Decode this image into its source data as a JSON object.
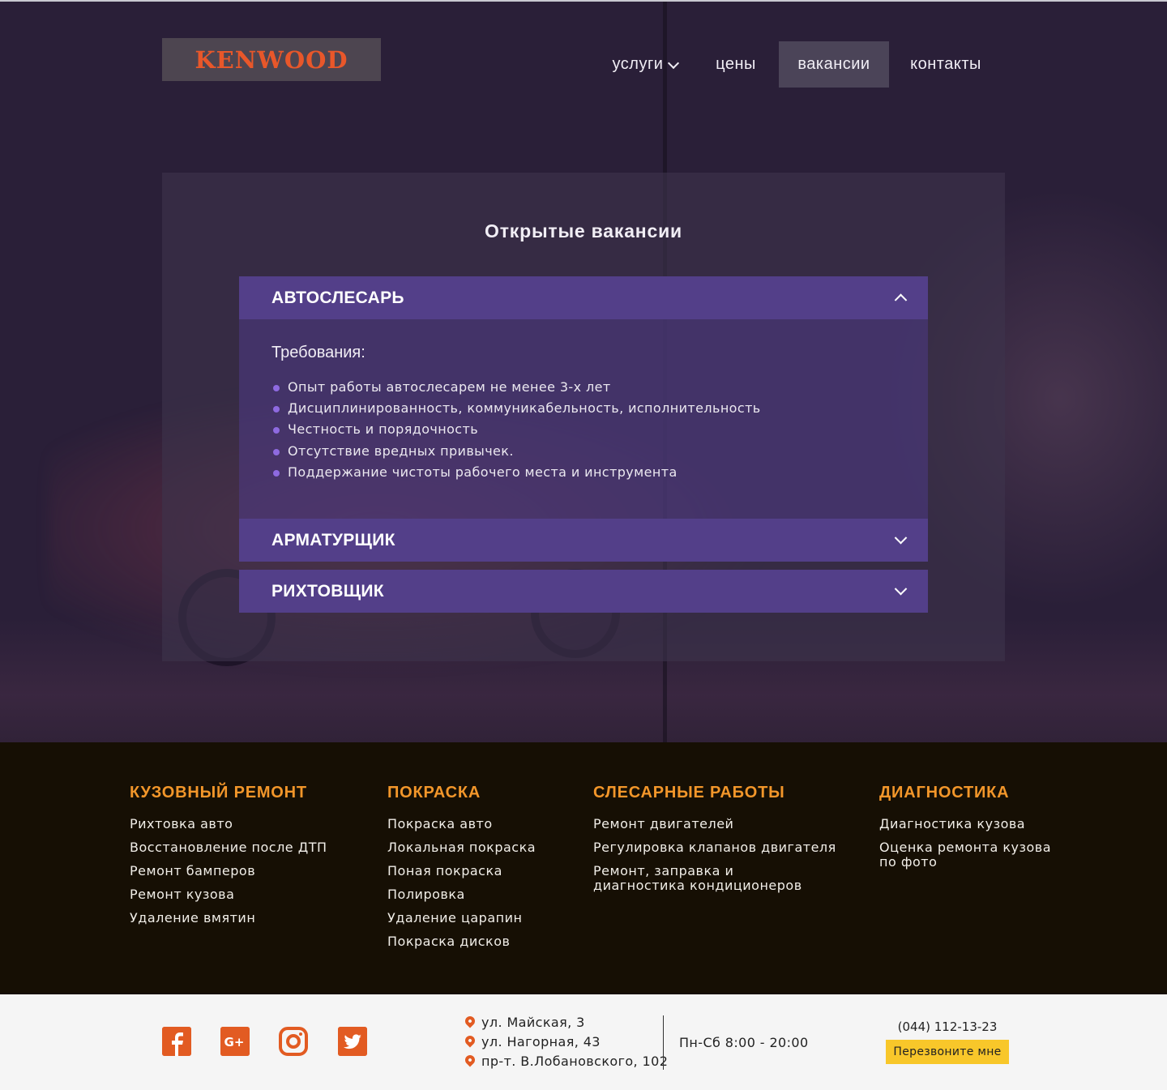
{
  "header": {
    "logo_text": "KENWOOD",
    "nav": [
      {
        "label": "услуги"
      },
      {
        "label": "цены"
      },
      {
        "label": "вакансии"
      },
      {
        "label": "контакты"
      }
    ],
    "active_nav": "вакансии"
  },
  "vacancies": {
    "title": "Открытые вакансии",
    "items": [
      {
        "name": "АВТОСЛЕСАРЬ",
        "expanded": true,
        "requirements_title": "Требования:",
        "requirements": [
          "Опыт работы автослесарем не менее 3-х лет",
          "Дисциплинированность, коммуникабельность, исполнительность",
          "Честность и порядочность",
          "Отсутствие вредных привычек.",
          "Поддержание чистоты рабочего места и инструмента"
        ]
      },
      {
        "name": "АРМАТУРЩИК",
        "expanded": false
      },
      {
        "name": "РИХТОВЩИК",
        "expanded": false
      }
    ]
  },
  "footer": {
    "columns": [
      {
        "title": "КУЗОВНЫЙ РЕМОНТ",
        "links": [
          "Рихтовка авто",
          "Восстановление после ДТП",
          "Ремонт бамперов",
          "Ремонт кузова",
          "Удаление вмятин"
        ]
      },
      {
        "title": "ПОКРАСКА",
        "links": [
          "Покраска авто",
          "Локальная покраска",
          "Поная покраска",
          "Полировка",
          "Удаление царапин",
          "Покраска дисков"
        ]
      },
      {
        "title": "СЛЕСАРНЫЕ РАБОТЫ",
        "links": [
          "Ремонт двигателей",
          "Регулировка клапанов двигателя",
          "Ремонт, заправка и\nдиагностика кондиционеров"
        ]
      },
      {
        "title": "ДИАГНОСТИКА",
        "links": [
          "Диагностика кузова",
          "Оценка ремонта кузова\nпо фото"
        ]
      }
    ],
    "social": [
      "facebook-icon",
      "google-plus-icon",
      "instagram-icon",
      "twitter-icon"
    ],
    "addresses": [
      "ул. Майская, 3",
      "ул. Нагорная, 43",
      "пр-т. В.Лобановского, 102"
    ],
    "hours": "Пн-Сб 8:00 - 20:00",
    "phone": "(044) 112-13-23",
    "callback_label": "Перезвоните мне"
  },
  "colors": {
    "accent_orange": "#f2962a",
    "accordion": "#533f89",
    "button_yellow": "#f8c72a",
    "social_orange": "#e25b22"
  }
}
